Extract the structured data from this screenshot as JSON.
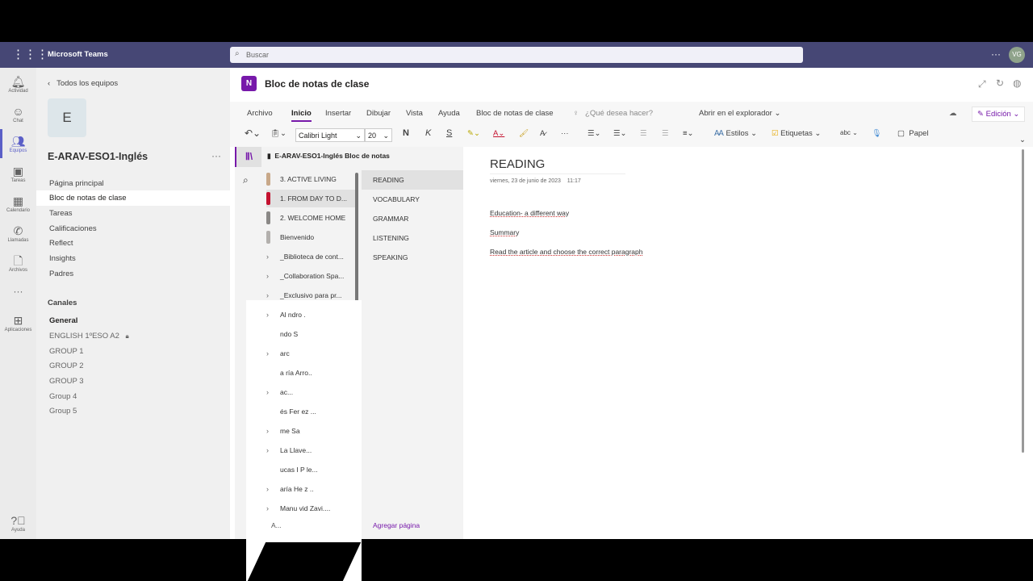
{
  "app": {
    "title": "Microsoft Teams",
    "search_placeholder": "Buscar",
    "avatar": "VG"
  },
  "rail": [
    {
      "label": "Actividad",
      "icon": "bell"
    },
    {
      "label": "Chat",
      "icon": "chat"
    },
    {
      "label": "Equipos",
      "icon": "teams"
    },
    {
      "label": "Tareas",
      "icon": "backpack"
    },
    {
      "label": "Calendario",
      "icon": "calendar"
    },
    {
      "label": "Llamadas",
      "icon": "phone"
    },
    {
      "label": "Archivos",
      "icon": "file"
    },
    {
      "label": "Aplicaciones",
      "icon": "apps"
    },
    {
      "label": "Ayuda",
      "icon": "help"
    }
  ],
  "team": {
    "back": "Todos los equipos",
    "avatar_letter": "E",
    "name": "E-ARAV-ESO1-Inglés",
    "nav": [
      "Página principal",
      "Bloc de notas de clase",
      "Tareas",
      "Calificaciones",
      "Reflect",
      "Insights",
      "Padres"
    ],
    "selected_nav": "Bloc de notas de clase",
    "channels_header": "Canales",
    "channels": [
      "General",
      "ENGLISH 1ºESO A2",
      "GROUP 1",
      "GROUP 2",
      "GROUP 3",
      "Group 4",
      "Group 5"
    ]
  },
  "onenote": {
    "title": "Bloc de notas de clase",
    "tabs": [
      "Archivo",
      "Inicio",
      "Insertar",
      "Dibujar",
      "Vista",
      "Ayuda",
      "Bloc de notas de clase"
    ],
    "active_tab": "Inicio",
    "tell_me": "¿Qué desea hacer?",
    "open_in_browser": "Abrir en el explorador",
    "mode": "Edición",
    "font": "Calibri Light",
    "font_size": "20",
    "bold": "N",
    "italic": "K",
    "underline": "S",
    "styles": "Estilos",
    "tags": "Etiquetas",
    "paper": "Papel",
    "notebook": "E-ARAV-ESO1-Inglés Bloc de notas",
    "sections": [
      {
        "name": "3. ACTIVE LIVING",
        "color": "#c8a889"
      },
      {
        "name": "1. FROM DAY TO D...",
        "color": "#c4122f"
      },
      {
        "name": "2. WELCOME HOME",
        "color": "#8a8886"
      },
      {
        "name": "Bienvenido",
        "color": "#b3b0ad"
      }
    ],
    "groups": [
      "_Biblioteca de cont...",
      "_Collaboration Spa...",
      "_Exclusivo para pr...",
      "Al    ndro .",
      "   ndo      S",
      "   arc      ",
      "   a    ría Arro..",
      "       ac...",
      "   és Fer    ez ...",
      "   me Sa     ",
      "       La Llave...",
      "  ucas   I P    le...",
      "   aría He     z ..",
      "Manu   vid Zavi...."
    ],
    "add_section": "A...",
    "pages": [
      "READING",
      "VOCABULARY",
      "GRAMMAR",
      "LISTENING",
      "SPEAKING"
    ],
    "selected_page": "READING",
    "add_page": "Agregar página",
    "page": {
      "title": "READING",
      "date": "viernes, 23 de junio de 2023",
      "time": "11:17",
      "lines": [
        "Education- a different way",
        "Summary",
        "Read the article and choose the correct paragraph"
      ]
    }
  },
  "colors": {
    "teams_purple": "#464775",
    "onenote_purple": "#7719aa"
  }
}
